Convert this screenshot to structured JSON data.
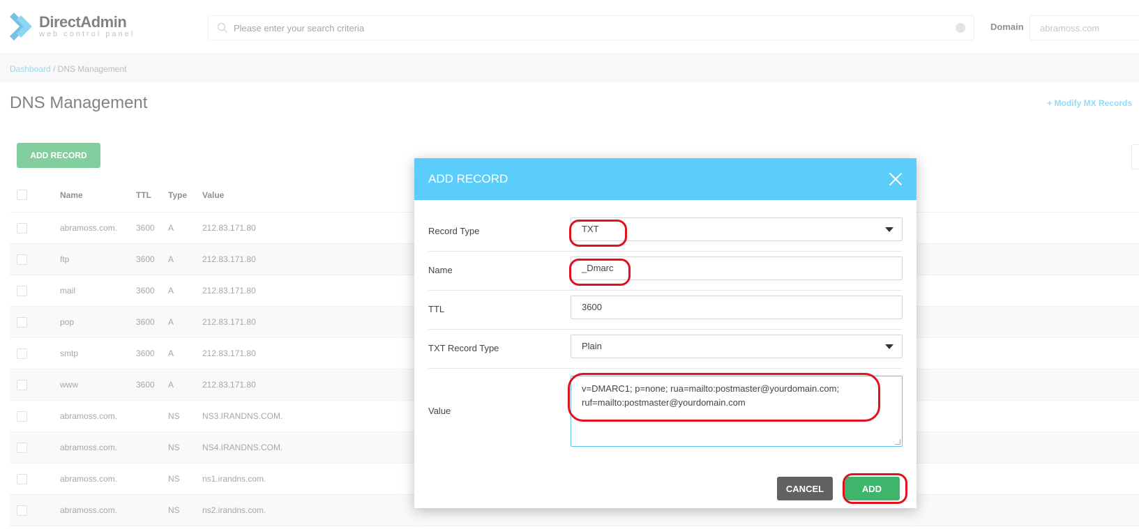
{
  "header": {
    "logo_title": "DirectAdmin",
    "logo_subtitle": "web control panel",
    "search_placeholder": "Please enter your search criteria",
    "domain_label": "Domain",
    "domain_value": "abramoss.com"
  },
  "breadcrumb": {
    "home": "Dashboard",
    "separator": " / ",
    "current": "DNS Management"
  },
  "page": {
    "title": "DNS Management",
    "modify_mx_link": "+ Modify MX Records",
    "add_record_button": "ADD RECORD"
  },
  "table": {
    "columns": [
      "Name",
      "TTL",
      "Type",
      "Value"
    ],
    "rows": [
      {
        "name": "abramoss.com.",
        "ttl": "3600",
        "type": "A",
        "value": "212.83.171.80"
      },
      {
        "name": "ftp",
        "ttl": "3600",
        "type": "A",
        "value": "212.83.171.80"
      },
      {
        "name": "mail",
        "ttl": "3600",
        "type": "A",
        "value": "212.83.171.80"
      },
      {
        "name": "pop",
        "ttl": "3600",
        "type": "A",
        "value": "212.83.171.80"
      },
      {
        "name": "smtp",
        "ttl": "3600",
        "type": "A",
        "value": "212.83.171.80"
      },
      {
        "name": "www",
        "ttl": "3600",
        "type": "A",
        "value": "212.83.171.80"
      },
      {
        "name": "abramoss.com.",
        "ttl": "",
        "type": "NS",
        "value": "NS3.IRANDNS.COM."
      },
      {
        "name": "abramoss.com.",
        "ttl": "",
        "type": "NS",
        "value": "NS4.IRANDNS.COM."
      },
      {
        "name": "abramoss.com.",
        "ttl": "",
        "type": "NS",
        "value": "ns1.irandns.com."
      },
      {
        "name": "abramoss.com.",
        "ttl": "",
        "type": "NS",
        "value": "ns2.irandns.com."
      }
    ]
  },
  "modal": {
    "title": "ADD RECORD",
    "fields": {
      "record_type_label": "Record Type",
      "record_type_value": "TXT",
      "name_label": "Name",
      "name_value": "_Dmarc",
      "ttl_label": "TTL",
      "ttl_value": "3600",
      "txt_type_label": "TXT Record Type",
      "txt_type_value": "Plain",
      "value_label": "Value",
      "value_value": "v=DMARC1; p=none; rua=mailto:postmaster@yourdomain.com;\nruf=mailto:postmaster@yourdomain.com"
    },
    "cancel_button": "CANCEL",
    "add_button": "ADD"
  },
  "colors": {
    "modal_header": "#5bcdfa",
    "primary_green": "#3fb46b",
    "annotation_red": "#e0101c",
    "link_blue": "#5bc5f2"
  }
}
